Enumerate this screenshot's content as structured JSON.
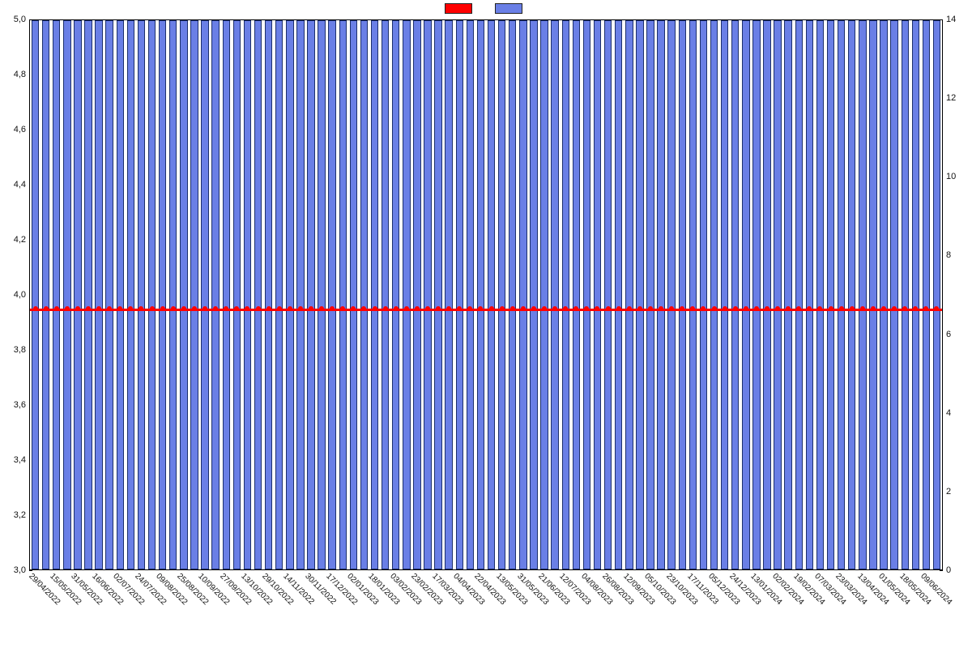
{
  "legend": {
    "series1_label": "",
    "series1_color": "#ff0000",
    "series2_label": "",
    "series2_color": "#6a7fe6"
  },
  "chart_data": {
    "type": "bar",
    "categories": [
      "29/04/2022",
      "15/05/2022",
      "31/05/2022",
      "16/06/2022",
      "02/07/2022",
      "24/07/2022",
      "09/08/2022",
      "25/08/2022",
      "10/09/2022",
      "27/09/2022",
      "13/10/2022",
      "29/10/2022",
      "14/11/2022",
      "30/11/2022",
      "17/12/2022",
      "02/01/2023",
      "18/01/2023",
      "03/02/2023",
      "23/02/2023",
      "17/03/2023",
      "04/04/2023",
      "22/04/2023",
      "13/05/2023",
      "31/05/2023",
      "21/06/2023",
      "12/07/2023",
      "04/08/2023",
      "26/08/2023",
      "12/09/2023",
      "05/10/2023",
      "23/10/2023",
      "17/11/2023",
      "05/12/2023",
      "24/12/2023",
      "13/01/2024",
      "02/02/2024",
      "19/02/2024",
      "07/03/2024",
      "23/03/2024",
      "13/04/2024",
      "01/05/2024",
      "18/05/2024",
      "09/06/2024"
    ],
    "x_label_every": 2,
    "bars_total": 86,
    "series": [
      {
        "name": "",
        "kind": "bar",
        "axis": "right",
        "constant_value": 14,
        "color": "#6a7fe6"
      },
      {
        "name": "",
        "kind": "line",
        "axis": "left",
        "constant_value": 3.95,
        "color": "#ff0000"
      }
    ],
    "left_axis": {
      "min": 3.0,
      "max": 5.0,
      "ticks": [
        3.0,
        3.2,
        3.4,
        3.6,
        3.8,
        4.0,
        4.2,
        4.4,
        4.6,
        4.8,
        5.0
      ],
      "tick_labels": [
        "3,0",
        "3,2",
        "3,4",
        "3,6",
        "3,8",
        "4,0",
        "4,2",
        "4,4",
        "4,6",
        "4,8",
        "5,0"
      ]
    },
    "right_axis": {
      "min": 0,
      "max": 14,
      "ticks": [
        0,
        2,
        4,
        6,
        8,
        10,
        12,
        14
      ],
      "tick_labels": [
        "0",
        "2",
        "4",
        "6",
        "8",
        "10",
        "12",
        "14"
      ]
    },
    "title": "",
    "xlabel": "",
    "ylabel_left": "",
    "ylabel_right": ""
  }
}
